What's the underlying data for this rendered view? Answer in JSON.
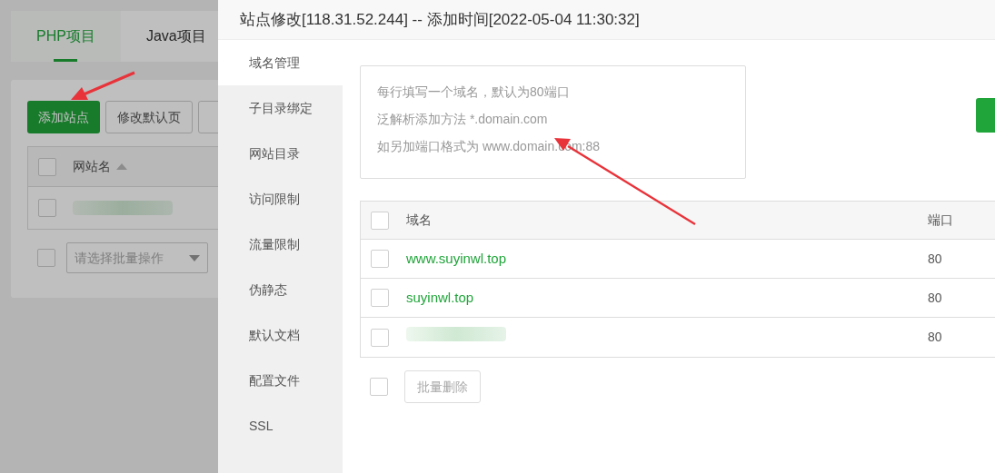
{
  "background_page": {
    "tabs": [
      {
        "label": "PHP项目",
        "selected": true
      },
      {
        "label": "Java项目",
        "selected": false
      }
    ],
    "toolbar": {
      "primary_button": "添加站点",
      "buttons": [
        "修改默认页"
      ]
    },
    "table": {
      "columns": [
        "网站名"
      ],
      "header_checked": false,
      "rows": [
        {
          "redacted": true,
          "checked": false
        }
      ]
    },
    "batch_select": {
      "placeholder": "请选择批量操作",
      "checked": false
    }
  },
  "dialog": {
    "title": "站点修改[118.31.52.244] -- 添加时间[2022-05-04 11:30:32]",
    "sidebar": [
      {
        "label": "域名管理",
        "selected": true
      },
      {
        "label": "子目录绑定",
        "selected": false
      },
      {
        "label": "网站目录",
        "selected": false
      },
      {
        "label": "访问限制",
        "selected": false
      },
      {
        "label": "流量限制",
        "selected": false
      },
      {
        "label": "伪静态",
        "selected": false
      },
      {
        "label": "默认文档",
        "selected": false
      },
      {
        "label": "配置文件",
        "selected": false
      },
      {
        "label": "SSL",
        "selected": false
      }
    ],
    "domain_input": {
      "placeholder": [
        "每行填写一个域名，默认为80端口",
        "泛解析添加方法 *.domain.com",
        "如另加端口格式为 www.domain.com:88"
      ]
    },
    "table": {
      "columns": [
        "域名",
        "端口"
      ],
      "header_checked": false,
      "rows": [
        {
          "domain": "www.suyinwl.top",
          "port": "80",
          "redacted": false,
          "checked": false
        },
        {
          "domain": "suyinwl.top",
          "port": "80",
          "redacted": false,
          "checked": false
        },
        {
          "domain": "",
          "port": "80",
          "redacted": true,
          "checked": false
        }
      ]
    },
    "batch_delete": {
      "label": "批量删除",
      "disabled": true,
      "checked": false
    }
  }
}
